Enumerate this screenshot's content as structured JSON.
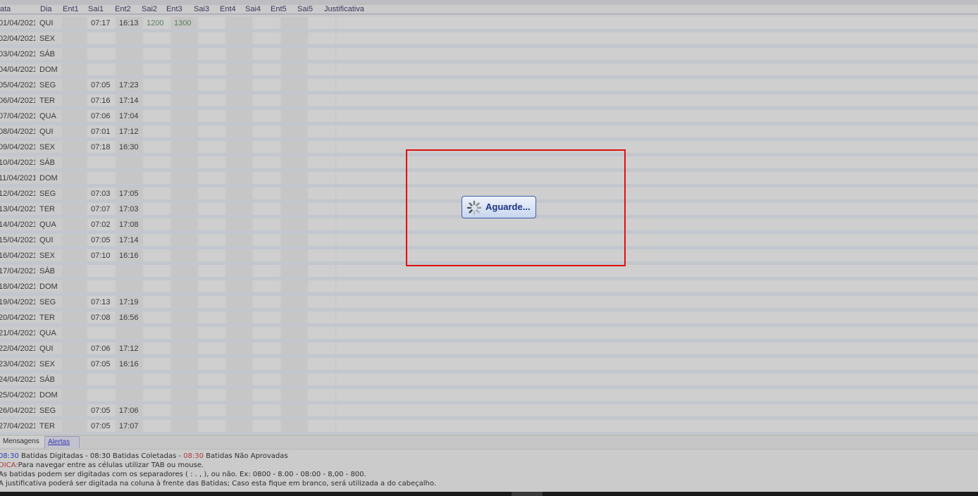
{
  "grid": {
    "headers": [
      "ata",
      "Dia",
      "Ent1",
      "Sai1",
      "Ent2",
      "Sai2",
      "Ent3",
      "Sai3",
      "Ent4",
      "Sai4",
      "Ent5",
      "Sai5",
      "Justificativa"
    ],
    "rows": [
      {
        "data": "01/04/2021",
        "dia": "QUI",
        "ent1": "",
        "sai1": "07:17",
        "ent2": "16:13",
        "sai2": "1200",
        "ent3": "1300"
      },
      {
        "data": "02/04/2021",
        "dia": "SEX",
        "ent1": "",
        "sai1": "",
        "ent2": "",
        "sai2": "",
        "ent3": ""
      },
      {
        "data": "03/04/2021",
        "dia": "SÁB",
        "ent1": "",
        "sai1": "",
        "ent2": "",
        "sai2": "",
        "ent3": ""
      },
      {
        "data": "04/04/2021",
        "dia": "DOM",
        "ent1": "",
        "sai1": "",
        "ent2": "",
        "sai2": "",
        "ent3": ""
      },
      {
        "data": "05/04/2021",
        "dia": "SEG",
        "ent1": "",
        "sai1": "07:05",
        "ent2": "17:23",
        "sai2": "",
        "ent3": ""
      },
      {
        "data": "06/04/2021",
        "dia": "TER",
        "ent1": "",
        "sai1": "07:16",
        "ent2": "17:14",
        "sai2": "",
        "ent3": ""
      },
      {
        "data": "07/04/2021",
        "dia": "QUA",
        "ent1": "",
        "sai1": "07:06",
        "ent2": "17:04",
        "sai2": "",
        "ent3": ""
      },
      {
        "data": "08/04/2021",
        "dia": "QUI",
        "ent1": "",
        "sai1": "07:01",
        "ent2": "17:12",
        "sai2": "",
        "ent3": ""
      },
      {
        "data": "09/04/2021",
        "dia": "SEX",
        "ent1": "",
        "sai1": "07:18",
        "ent2": "16:30",
        "sai2": "",
        "ent3": ""
      },
      {
        "data": "10/04/2021",
        "dia": "SÁB",
        "ent1": "",
        "sai1": "",
        "ent2": "",
        "sai2": "",
        "ent3": ""
      },
      {
        "data": "11/04/2021",
        "dia": "DOM",
        "ent1": "",
        "sai1": "",
        "ent2": "",
        "sai2": "",
        "ent3": ""
      },
      {
        "data": "12/04/2021",
        "dia": "SEG",
        "ent1": "",
        "sai1": "07:03",
        "ent2": "17:05",
        "sai2": "",
        "ent3": ""
      },
      {
        "data": "13/04/2021",
        "dia": "TER",
        "ent1": "",
        "sai1": "07:07",
        "ent2": "17:03",
        "sai2": "",
        "ent3": ""
      },
      {
        "data": "14/04/2021",
        "dia": "QUA",
        "ent1": "",
        "sai1": "07:02",
        "ent2": "17:08",
        "sai2": "",
        "ent3": ""
      },
      {
        "data": "15/04/2021",
        "dia": "QUI",
        "ent1": "",
        "sai1": "07:05",
        "ent2": "17:14",
        "sai2": "",
        "ent3": ""
      },
      {
        "data": "16/04/2021",
        "dia": "SEX",
        "ent1": "",
        "sai1": "07:10",
        "ent2": "16:16",
        "sai2": "",
        "ent3": ""
      },
      {
        "data": "17/04/2021",
        "dia": "SÁB",
        "ent1": "",
        "sai1": "",
        "ent2": "",
        "sai2": "",
        "ent3": ""
      },
      {
        "data": "18/04/2021",
        "dia": "DOM",
        "ent1": "",
        "sai1": "",
        "ent2": "",
        "sai2": "",
        "ent3": ""
      },
      {
        "data": "19/04/2021",
        "dia": "SEG",
        "ent1": "",
        "sai1": "07:13",
        "ent2": "17:19",
        "sai2": "",
        "ent3": ""
      },
      {
        "data": "20/04/2021",
        "dia": "TER",
        "ent1": "",
        "sai1": "07:08",
        "ent2": "16:56",
        "sai2": "",
        "ent3": ""
      },
      {
        "data": "21/04/2021",
        "dia": "QUA",
        "ent1": "",
        "sai1": "",
        "ent2": "",
        "sai2": "",
        "ent3": ""
      },
      {
        "data": "22/04/2021",
        "dia": "QUI",
        "ent1": "",
        "sai1": "07:06",
        "ent2": "17:12",
        "sai2": "",
        "ent3": ""
      },
      {
        "data": "23/04/2021",
        "dia": "SEX",
        "ent1": "",
        "sai1": "07:05",
        "ent2": "16:16",
        "sai2": "",
        "ent3": ""
      },
      {
        "data": "24/04/2021",
        "dia": "SÁB",
        "ent1": "",
        "sai1": "",
        "ent2": "",
        "sai2": "",
        "ent3": ""
      },
      {
        "data": "25/04/2021",
        "dia": "DOM",
        "ent1": "",
        "sai1": "",
        "ent2": "",
        "sai2": "",
        "ent3": ""
      },
      {
        "data": "26/04/2021",
        "dia": "SEG",
        "ent1": "",
        "sai1": "07:05",
        "ent2": "17:06",
        "sai2": "",
        "ent3": ""
      },
      {
        "data": "27/04/2021",
        "dia": "TER",
        "ent1": "",
        "sai1": "07:05",
        "ent2": "17:07",
        "sai2": "",
        "ent3": ""
      }
    ]
  },
  "tabs": [
    {
      "label": "Mensagens",
      "active": true
    },
    {
      "label": "Alertas",
      "active": false
    }
  ],
  "messages": {
    "line1": {
      "time1": "08:30",
      "text1": " Batidas Digitadas - 08:30 Batidas Coletadas - ",
      "time2": "08:30",
      "text2": " Batidas Não Aprovadas"
    },
    "line2": {
      "prefix": "DICA:",
      "text": "Para navegar entre as células utilizar TAB ou mouse."
    },
    "line3": "As batidas podem ser digitadas com os separadores ( : . , ), ou não. Ex: 0800 - 8.00 - 08:00 - 8,00 - 800.",
    "line4": "A justificativa poderá ser digitada na coluna à frente das Batidas; Caso esta fique em branco, será utilizada a do cabeçalho."
  },
  "loading": {
    "label": "Aguarde..."
  },
  "colors": {
    "highlight_border": "#e01010",
    "link": "#3737b0",
    "loading_text": "#1d3384"
  }
}
